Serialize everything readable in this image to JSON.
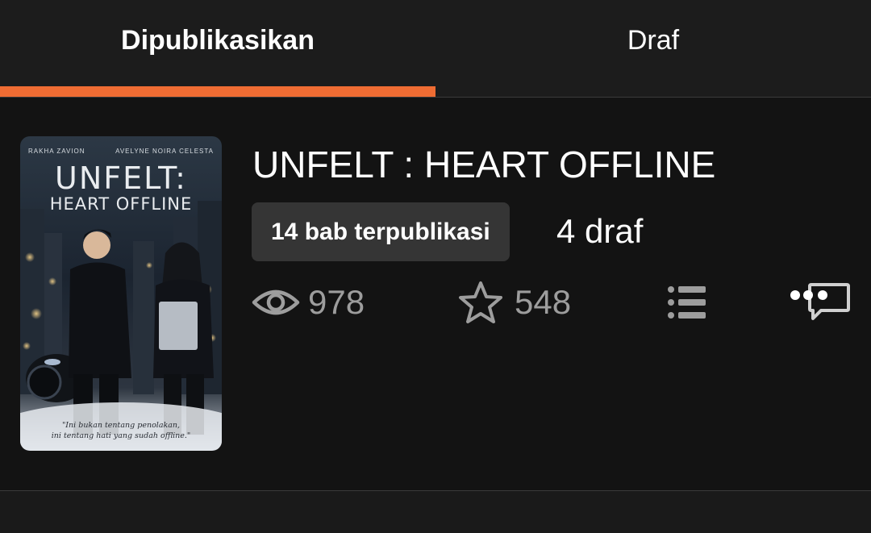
{
  "tabs": {
    "published_label": "Dipublikasikan",
    "draft_label": "Draf"
  },
  "colors": {
    "accent": "#ef6c33",
    "background": "#1a1a1a",
    "card": "#131313",
    "badge": "#353535",
    "muted_text": "#9d9d9d"
  },
  "story": {
    "title": "UNFELT : HEART OFFLINE",
    "published_chapters": "14 bab terpublikasi",
    "drafts": "4 draf",
    "views": "978",
    "votes": "548",
    "cover": {
      "author_left": "RAKHA ZAVION",
      "author_right": "AVELYNE NOIRA CELESTA",
      "title": "UNFELT:",
      "subtitle": "HEART OFFLINE",
      "quote_line_1": "\"Ini bukan tentang penolakan,",
      "quote_line_2": "ini tentang hati yang sudah offline.\""
    }
  },
  "icons": {
    "views": "eye-icon",
    "votes": "star-icon",
    "table_of_contents": "list-icon",
    "comments": "comment-icon"
  }
}
